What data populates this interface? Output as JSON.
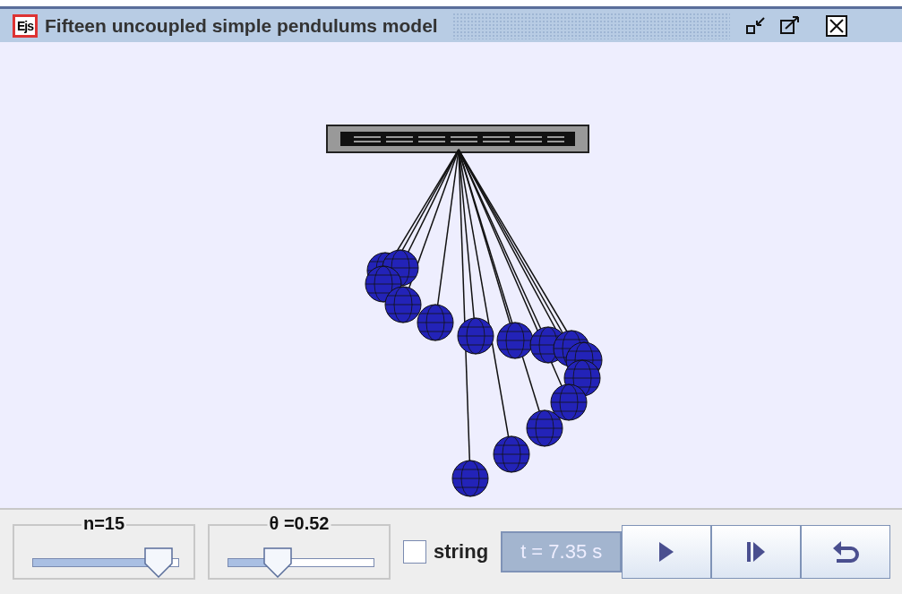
{
  "window": {
    "title": "Fifteen uncoupled simple pendulums model",
    "logo": "Ejs"
  },
  "sliders": [
    {
      "label": "n=15",
      "level": 0.95
    },
    {
      "label": "θ =0.52",
      "level": 0.3
    }
  ],
  "checkbox": {
    "label": "string",
    "checked": false
  },
  "time_display": "t = 7.35 s",
  "buttons": [
    {
      "kind": "play"
    },
    {
      "kind": "step"
    },
    {
      "kind": "reset"
    }
  ]
}
